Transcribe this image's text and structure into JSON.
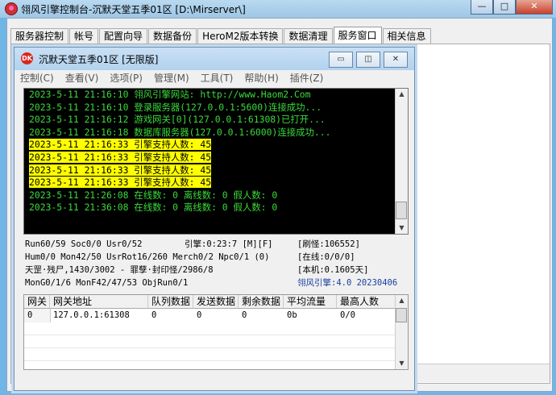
{
  "outer_window": {
    "title": "翎风引擎控制台-沉默天堂五季01区 [D:\\Mirserver\\]",
    "minimize": "—",
    "maximize": "□",
    "close": "✕"
  },
  "tabs": [
    {
      "label": "服务器控制",
      "active": false
    },
    {
      "label": "帐号",
      "active": false
    },
    {
      "label": "配置向导",
      "active": false
    },
    {
      "label": "数据备份",
      "active": false
    },
    {
      "label": "HeroM2版本转换",
      "active": false
    },
    {
      "label": "数据清理",
      "active": false
    },
    {
      "label": "服务窗口",
      "active": true
    },
    {
      "label": "相关信息",
      "active": false
    }
  ],
  "child_window": {
    "icon_text": "DK",
    "title": "沉默天堂五季01区 [无限版]",
    "buttons": {
      "minimize": "▭",
      "restore": "◫",
      "close": "✕"
    },
    "menu": [
      "控制(C)",
      "查看(V)",
      "选项(P)",
      "管理(M)",
      "工具(T)",
      "帮助(H)",
      "插件(Z)"
    ]
  },
  "log": [
    {
      "time": "2023-5-11 21:16:10",
      "msg": "翎风引擎网站: http://www.Haom2.Com",
      "highlight": false
    },
    {
      "time": "2023-5-11 21:16:10",
      "msg": "登录服务器(127.0.0.1:5600)连接成功...",
      "highlight": false
    },
    {
      "time": "2023-5-11 21:16:12",
      "msg": "游戏网关[0](127.0.0.1:61308)已打开...",
      "highlight": false
    },
    {
      "time": "2023-5-11 21:16:18",
      "msg": "数据库服务器(127.0.0.1:6000)连接成功...",
      "highlight": false
    },
    {
      "time": "2023-5-11 21:16:33",
      "msg": "引擎支持人数: 45",
      "highlight": true
    },
    {
      "time": "2023-5-11 21:16:33",
      "msg": "引擎支持人数: 45",
      "highlight": true
    },
    {
      "time": "2023-5-11 21:16:33",
      "msg": "引擎支持人数: 45",
      "highlight": true
    },
    {
      "time": "2023-5-11 21:16:33",
      "msg": "引擎支持人数: 45",
      "highlight": true
    },
    {
      "time": "2023-5-11 21:26:08",
      "msg": "在线数: 0 离线数: 0 假人数: 0",
      "highlight": false
    },
    {
      "time": "2023-5-11 21:36:08",
      "msg": "在线数: 0 离线数: 0 假人数: 0",
      "highlight": false
    }
  ],
  "status": {
    "r1c1": "Run60/59 Soc0/0 Usr0/52",
    "r1c2": "引擎:0:23:7 [M][F]",
    "r1c3": "[刷怪:106552]",
    "r2c1": "Hum0/0 Mon42/50 UsrRot16/260 Merch0/2 Npc0/1 (0)",
    "r2c3": "[在线:0/0/0]",
    "r3c1": "天罡·残尸,1430/3002 - 罪孽·封印怪/2986/8",
    "r3c3": "[本机:0.1605天]",
    "r4c1": "MonG0/1/6 MonF42/47/53 ObjRun0/1",
    "r4c3": "翎风引擎:4.0 20230406"
  },
  "gateway_table": {
    "headers": [
      "网关",
      "网关地址",
      "队列数据",
      "发送数据",
      "剩余数据",
      "平均流量",
      "最高人数"
    ],
    "rows": [
      [
        "0",
        "127.0.0.1:61308",
        "0",
        "0",
        "0",
        "0b",
        "0/0"
      ]
    ]
  }
}
